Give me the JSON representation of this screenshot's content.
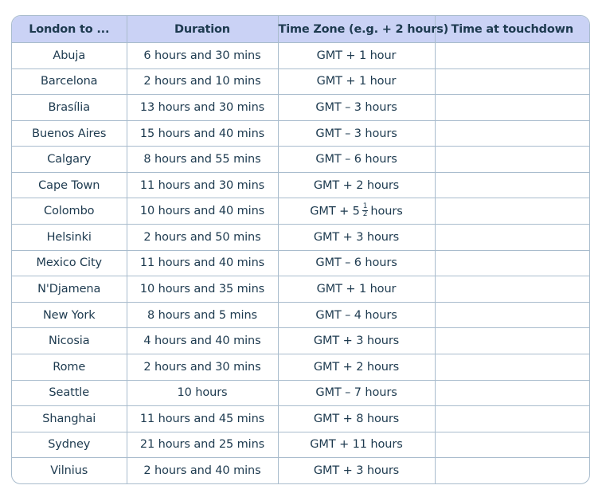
{
  "table": {
    "headers": [
      "London to ...",
      "Duration",
      "Time Zone (e.g. + 2 hours)",
      "Time at touchdown"
    ],
    "rows": [
      {
        "destination": "Abuja",
        "duration": "6 hours and 30 mins",
        "time_zone": "GMT + 1 hour",
        "touchdown": ""
      },
      {
        "destination": "Barcelona",
        "duration": "2 hours and 10 mins",
        "time_zone": "GMT + 1 hour",
        "touchdown": ""
      },
      {
        "destination": "Brasília",
        "duration": "13 hours and 30 mins",
        "time_zone": "GMT – 3 hours",
        "touchdown": ""
      },
      {
        "destination": "Buenos Aires",
        "duration": "15 hours and 40 mins",
        "time_zone": "GMT – 3 hours",
        "touchdown": ""
      },
      {
        "destination": "Calgary",
        "duration": "8 hours and 55 mins",
        "time_zone": "GMT – 6 hours",
        "touchdown": ""
      },
      {
        "destination": "Cape Town",
        "duration": "11 hours and 30 mins",
        "time_zone": "GMT + 2 hours",
        "touchdown": ""
      },
      {
        "destination": "Colombo",
        "duration": "10 hours and 40 mins",
        "time_zone_parts": {
          "prefix": "GMT + 5",
          "frac_num": "1",
          "frac_den": "2",
          "suffix": "hours"
        },
        "touchdown": ""
      },
      {
        "destination": "Helsinki",
        "duration": "2 hours and 50 mins",
        "time_zone": "GMT + 3 hours",
        "touchdown": ""
      },
      {
        "destination": "Mexico City",
        "duration": "11 hours and 40 mins",
        "time_zone": "GMT – 6 hours",
        "touchdown": ""
      },
      {
        "destination": "N'Djamena",
        "duration": "10 hours and 35 mins",
        "time_zone": "GMT + 1 hour",
        "touchdown": ""
      },
      {
        "destination": "New York",
        "duration": "8 hours and 5 mins",
        "time_zone": "GMT – 4 hours",
        "touchdown": ""
      },
      {
        "destination": "Nicosia",
        "duration": "4 hours and 40 mins",
        "time_zone": "GMT + 3 hours",
        "touchdown": ""
      },
      {
        "destination": "Rome",
        "duration": "2 hours and 30 mins",
        "time_zone": "GMT + 2 hours",
        "touchdown": ""
      },
      {
        "destination": "Seattle",
        "duration": "10 hours",
        "time_zone": "GMT – 7 hours",
        "touchdown": ""
      },
      {
        "destination": "Shanghai",
        "duration": "11 hours and 45 mins",
        "time_zone": "GMT + 8 hours",
        "touchdown": ""
      },
      {
        "destination": "Sydney",
        "duration": "21 hours and 25 mins",
        "time_zone": "GMT + 11 hours",
        "touchdown": ""
      },
      {
        "destination": "Vilnius",
        "duration": "2 hours and 40 mins",
        "time_zone": "GMT + 3 hours",
        "touchdown": ""
      }
    ]
  },
  "colors": {
    "header_bg": "#cad2f5",
    "border": "#a9bccd",
    "text": "#1d3a4f"
  }
}
